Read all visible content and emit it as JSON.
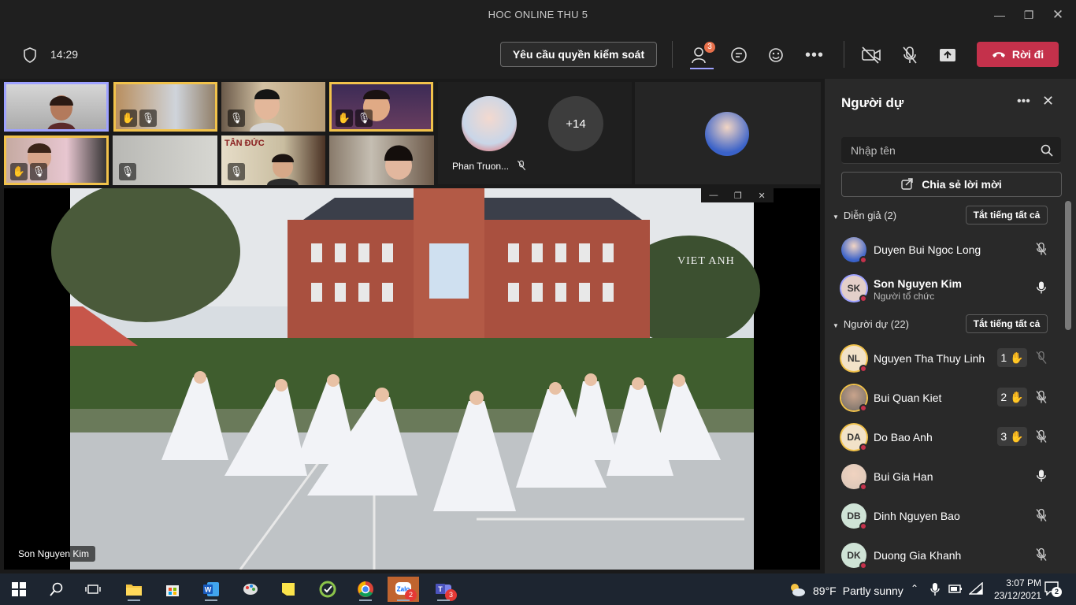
{
  "window": {
    "title": "HOC ONLINE THU 5"
  },
  "toolbar": {
    "time": "14:29",
    "request_control": "Yêu cầu quyền kiểm soát",
    "participants_badge": "3",
    "leave": "Rời đi"
  },
  "stage": {
    "presenter_tile_name": "Phan Truon...",
    "overflow_count": "+14",
    "video_caption_brand": "VIET ANH",
    "sign_text": "TÂN ĐỨC",
    "main_name": "Son Nguyen Kim"
  },
  "panel": {
    "title": "Người dự",
    "search_placeholder": "Nhập tên",
    "share": "Chia sẻ lời mời",
    "presenters_header": "Diễn giả (2)",
    "attendees_header": "Người dự (22)",
    "mute_all": "Tắt tiếng tất cả",
    "presenters": [
      {
        "name": "Duyen Bui Ngoc Long",
        "sub": "",
        "initials": ""
      },
      {
        "name": "Son Nguyen Kim",
        "sub": "Người tổ chức",
        "initials": "SK"
      }
    ],
    "attendees": [
      {
        "name": "Nguyen Tha Thuy Linh",
        "initials": "NL",
        "hand": "1"
      },
      {
        "name": "Bui Quan Kiet",
        "initials": "",
        "hand": "2"
      },
      {
        "name": "Do Bao Anh",
        "initials": "DA",
        "hand": "3"
      },
      {
        "name": "Bui Gia Han",
        "initials": "",
        "hand": ""
      },
      {
        "name": "Dinh Nguyen Bao",
        "initials": "DB",
        "hand": ""
      },
      {
        "name": "Duong Gia Khanh",
        "initials": "DK",
        "hand": ""
      }
    ]
  },
  "taskbar": {
    "zalo_badge": "2",
    "teams_badge": "3",
    "temp": "89°F",
    "weather": "Partly sunny",
    "clock_time": "3:07 PM",
    "clock_date": "23/12/2021",
    "notif_count": "2"
  },
  "colors": {
    "accent": "#9ea2ff",
    "leave": "#c4314b",
    "raised_hand": "#f1c24b"
  }
}
